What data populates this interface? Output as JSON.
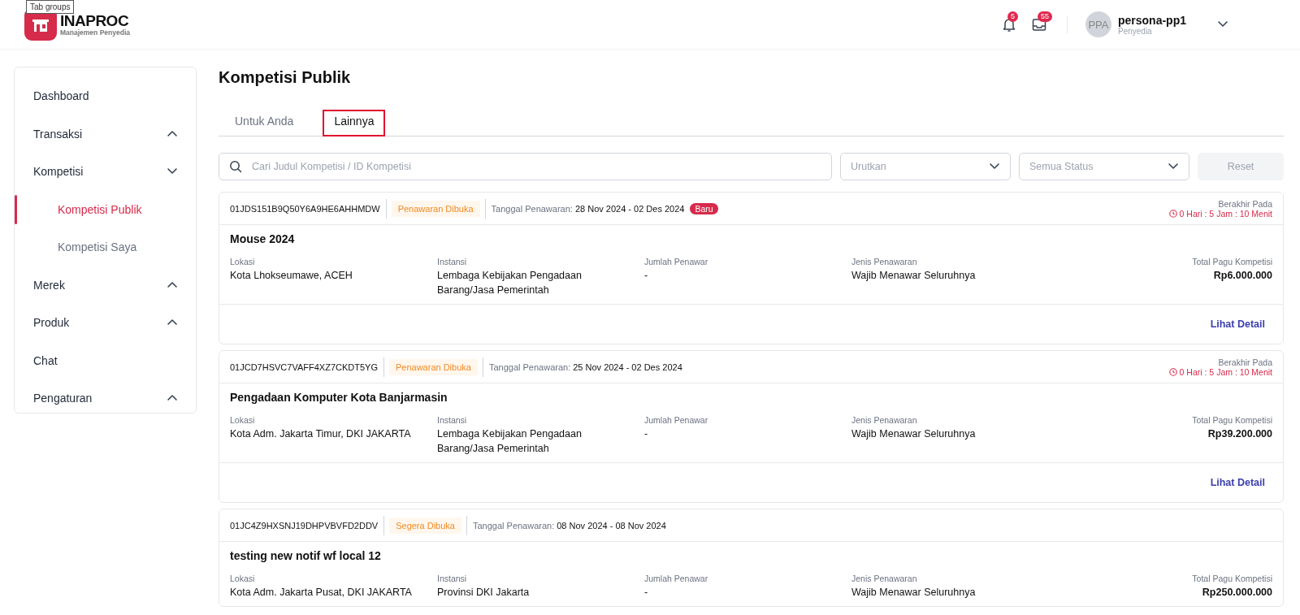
{
  "tooltip": "Tab groups",
  "header": {
    "logo_title": "INAPROC",
    "logo_subtitle": "Manajemen Penyedia",
    "notifications": "5",
    "inbox": "55",
    "user": {
      "initials": "PPA",
      "name": "persona-pp1",
      "role": "Penyedia"
    }
  },
  "sidebar": {
    "items": [
      {
        "label": "Dashboard",
        "selected": false
      },
      {
        "label": "Transaksi",
        "selected": false,
        "expanded": false
      },
      {
        "label": "Kompetisi",
        "selected": false,
        "expanded": true,
        "children": [
          {
            "label": "Kompetisi Publik",
            "selected": true
          },
          {
            "label": "Kompetisi Saya",
            "selected": false
          }
        ]
      },
      {
        "label": "Merek",
        "selected": false,
        "expanded": false
      },
      {
        "label": "Produk",
        "selected": false,
        "expanded": false
      },
      {
        "label": "Chat",
        "selected": false
      },
      {
        "label": "Pengaturan",
        "selected": false,
        "expanded": false
      }
    ]
  },
  "page_title": "Kompetisi Publik",
  "tabs": [
    {
      "label": "Untuk Anda",
      "selected": false,
      "highlighted": false
    },
    {
      "label": "Lainnya",
      "selected": true,
      "highlighted": true
    }
  ],
  "filters": {
    "search": {
      "placeholder": "Cari Judul Kompetisi / ID Kompetisi"
    },
    "sort": {
      "placeholder": "Urutkan"
    },
    "status": {
      "placeholder": "Semua Status"
    },
    "reset": {
      "label": "Reset",
      "disabled": true
    }
  },
  "cards": [
    {
      "id": "01JDS151B9Q50Y6A9HE6AHHMDW",
      "status": "Penawaran Dibuka",
      "date_label": "Tanggal Penawaran:",
      "date_range": "28 Nov 2024 - 02 Des 2024",
      "badge": "Baru",
      "deadline": {
        "label": "Berakhir Pada",
        "countdown": "0 Hari : 5 Jam : 10 Menit"
      },
      "title": "Mouse 2024",
      "fields": [
        {
          "label": "Lokasi",
          "value": "Kota Lhokseumawe, ACEH"
        },
        {
          "label": "Instansi",
          "value": "Lembaga Kebijakan Pengadaan Barang/Jasa Pemerintah"
        },
        {
          "label": "Jumlah Penawar",
          "value": "-"
        },
        {
          "label": "Jenis Penawaran",
          "value": "Wajib Menawar Seluruhnya"
        },
        {
          "label": "Total Pagu Kompetisi",
          "value": "Rp6.000.000"
        }
      ],
      "link": "Lihat Detail"
    },
    {
      "id": "01JCD7HSVC7VAFF4XZ7CKDT5YG",
      "status": "Penawaran Dibuka",
      "date_label": "Tanggal Penawaran:",
      "date_range": "25 Nov 2024 - 02 Des 2024",
      "deadline": {
        "label": "Berakhir Pada",
        "countdown": "0 Hari : 5 Jam : 10 Menit"
      },
      "title": "Pengadaan Komputer Kota Banjarmasin",
      "fields": [
        {
          "label": "Lokasi",
          "value": "Kota Adm. Jakarta Timur, DKI JAKARTA"
        },
        {
          "label": "Instansi",
          "value": "Lembaga Kebijakan Pengadaan Barang/Jasa Pemerintah"
        },
        {
          "label": "Jumlah Penawar",
          "value": "-"
        },
        {
          "label": "Jenis Penawaran",
          "value": "Wajib Menawar Seluruhnya"
        },
        {
          "label": "Total Pagu Kompetisi",
          "value": "Rp39.200.000"
        }
      ],
      "link": "Lihat Detail"
    },
    {
      "id": "01JC4Z9HXSNJ19DHPVBVFD2DDV",
      "status": "Segera Dibuka",
      "date_label": "Tanggal Penawaran:",
      "date_range": "08 Nov 2024 - 08 Nov 2024",
      "title": "testing new notif wf local 12",
      "fields": [
        {
          "label": "Lokasi",
          "value": "Kota Adm. Jakarta Pusat, DKI JAKARTA"
        },
        {
          "label": "Instansi",
          "value": "Provinsi DKI Jakarta"
        },
        {
          "label": "Jumlah Penawar",
          "value": "-"
        },
        {
          "label": "Jenis Penawaran",
          "value": "Wajib Menawar Seluruhnya"
        },
        {
          "label": "Total Pagu Kompetisi",
          "value": "Rp250.000.000"
        }
      ]
    }
  ]
}
